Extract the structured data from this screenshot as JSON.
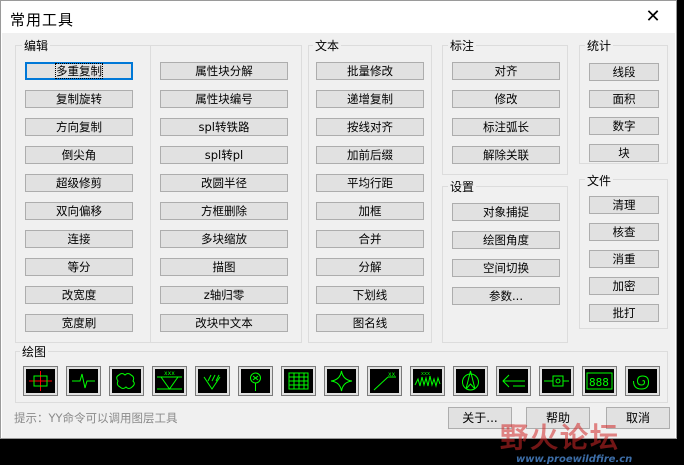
{
  "window": {
    "title": "常用工具",
    "close_glyph": "✕"
  },
  "groups": {
    "edit": {
      "label": "编辑",
      "col1": [
        "多重复制",
        "复制旋转",
        "方向复制",
        "倒尖角",
        "超级修剪",
        "双向偏移",
        "连接",
        "等分",
        "改宽度",
        "宽度刷"
      ],
      "col2": [
        "属性块分解",
        "属性块编号",
        "spl转铁路",
        "spl转pl",
        "改圆半径",
        "方框删除",
        "多块缩放",
        "描图",
        "z轴归零",
        "改块中文本"
      ]
    },
    "text": {
      "label": "文本",
      "items": [
        "批量修改",
        "递增复制",
        "按线对齐",
        "加前后缀",
        "平均行距",
        "加框",
        "合并",
        "分解",
        "下划线",
        "图名线"
      ]
    },
    "dim": {
      "label": "标注",
      "items": [
        "对齐",
        "修改",
        "标注弧长",
        "解除关联"
      ]
    },
    "settings": {
      "label": "设置",
      "items": [
        "对象捕捉",
        "绘图角度",
        "空间切换",
        "参数..."
      ]
    },
    "stats": {
      "label": "统计",
      "items": [
        "线段",
        "面积",
        "数字",
        "块"
      ]
    },
    "file": {
      "label": "文件",
      "items": [
        "清理",
        "核查",
        "消重",
        "加密",
        "批打"
      ]
    },
    "draw": {
      "label": "绘图",
      "icons": [
        "crosshair-icon",
        "break-line-icon",
        "cloud-icon",
        "triangle-hatch-icon",
        "slash-marks-icon",
        "circle-marker-icon",
        "grid-table-icon",
        "star-icon",
        "leader-icon",
        "zigzag-icon",
        "north-arrow-icon",
        "left-arrow-icon",
        "box-arrow-icon",
        "digits-icon",
        "spiral-icon"
      ],
      "digits_text": "888"
    }
  },
  "footer": {
    "hint": "提示：YY命令可以调用图层工具",
    "about_label": "关于...",
    "help_label": "帮助",
    "cancel_label": "取消"
  },
  "watermark": {
    "text": "野火论坛",
    "url": "www.proewildfire.cn"
  },
  "colors": {
    "icon_bg": "#000000",
    "icon_stroke": "#00ff00",
    "icon_red": "#ff0000",
    "focus": "#0078d7",
    "watermark": "#d22828"
  }
}
